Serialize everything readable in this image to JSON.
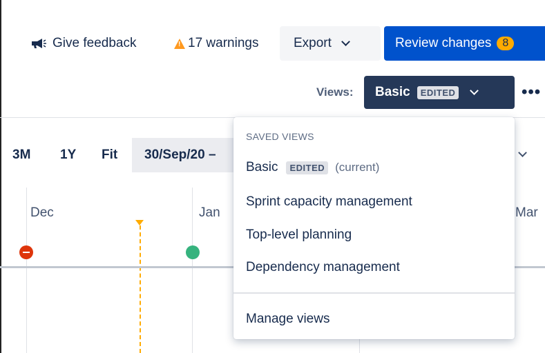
{
  "toolbar": {
    "feedback_label": "Give feedback",
    "warnings_label": "17 warnings",
    "export_label": "Export",
    "review_label": "Review changes",
    "review_count": "8"
  },
  "views": {
    "label": "Views:",
    "current": "Basic",
    "edited_badge": "EDITED",
    "more_label": "•••"
  },
  "timeline": {
    "zoom_options": [
      "3M",
      "1Y",
      "Fit"
    ],
    "date_range": "30/Sep/20 –",
    "months": [
      "Dec",
      "Jan",
      "Mar"
    ]
  },
  "menu": {
    "heading": "SAVED VIEWS",
    "items": [
      {
        "label": "Basic",
        "badge": "EDITED",
        "note": "(current)"
      },
      {
        "label": "Sprint capacity management"
      },
      {
        "label": "Top-level planning"
      },
      {
        "label": "Dependency management"
      }
    ],
    "manage_label": "Manage views"
  },
  "colors": {
    "primary": "#0052CC",
    "dark_button": "#253858",
    "warning": "#FFAB00",
    "danger": "#DE350B",
    "success": "#36B37E"
  }
}
